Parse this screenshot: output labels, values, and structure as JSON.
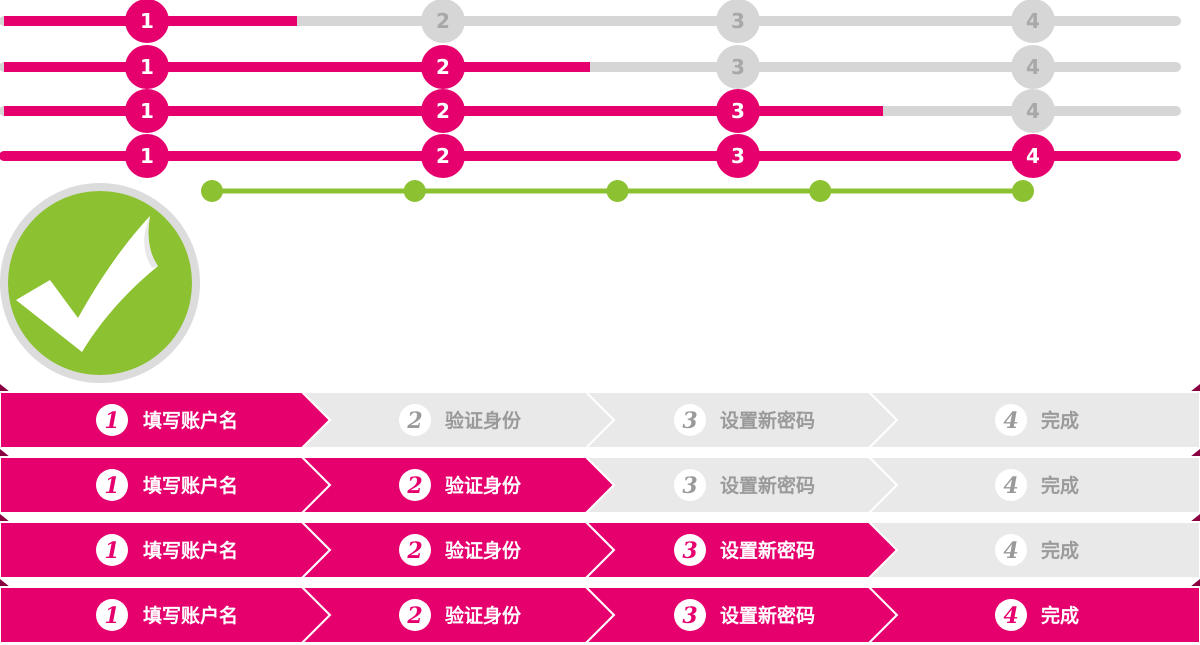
{
  "colors": {
    "accent": "#e6006e",
    "inactive": "#d6d6d6",
    "inactive_text": "#a8a8a8",
    "success": "#8cc131",
    "success_border": "#dcdcdc",
    "arrow_inactive": "#e9e9e9",
    "arrow_inactive_text": "#9a9a9a"
  },
  "progress_bars": {
    "steps": [
      "1",
      "2",
      "3",
      "4"
    ],
    "rows": [
      {
        "active_steps": 1,
        "fill_fraction": 0.25
      },
      {
        "active_steps": 2,
        "fill_fraction": 0.5
      },
      {
        "active_steps": 3,
        "fill_fraction": 0.75
      },
      {
        "active_steps": 4,
        "fill_fraction": 1.0
      }
    ]
  },
  "green_track": {
    "dots": 5
  },
  "success_icon": {
    "name": "checkmark-icon"
  },
  "arrow_steps": {
    "steps": [
      {
        "number": "1",
        "label": "填写账户名"
      },
      {
        "number": "2",
        "label": "验证身份"
      },
      {
        "number": "3",
        "label": "设置新密码"
      },
      {
        "number": "4",
        "label": "完成"
      }
    ],
    "rows": [
      {
        "active_steps": 1
      },
      {
        "active_steps": 2
      },
      {
        "active_steps": 3
      },
      {
        "active_steps": 4
      }
    ]
  }
}
